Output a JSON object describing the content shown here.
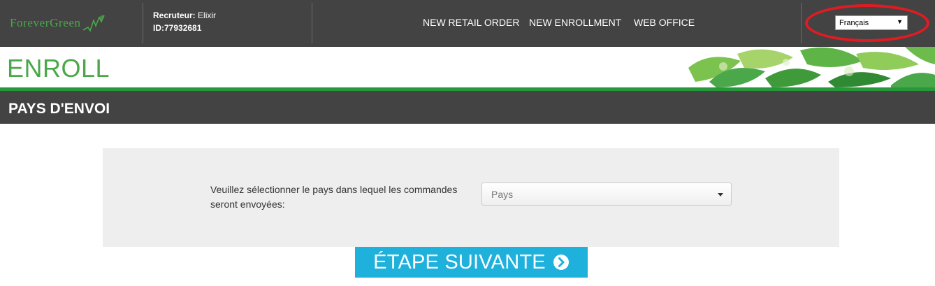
{
  "header": {
    "logo_text": "ForeverGreen",
    "recruiter_label": "Recruteur:",
    "recruiter_name": "Elixir",
    "recruiter_id": "ID:77932681",
    "nav": [
      {
        "label": "NEW RETAIL ORDER"
      },
      {
        "label": "NEW ENROLLMENT"
      },
      {
        "label": "WEB OFFICE"
      }
    ],
    "language_selected": "Français"
  },
  "page": {
    "title": "ENROLL",
    "section_title": "PAYS D'ENVOI"
  },
  "form": {
    "prompt": "Veuillez sélectionner le pays dans lequel les commandes seront envoyées:",
    "country_placeholder": "Pays"
  },
  "actions": {
    "next_label": "ÉTAPE SUIVANTE"
  },
  "colors": {
    "header_bg": "#434343",
    "brand_green": "#4aa84a",
    "accent_green_line": "#27993a",
    "button_blue": "#1eb1dc",
    "panel_bg": "#eeeeee",
    "highlight_red": "#e11b22"
  },
  "icons": {
    "logo_mark": "leaf-zigzag-icon",
    "lang_dropdown": "triangle-down-icon",
    "country_dropdown": "caret-down-icon",
    "next": "chevron-circle-right-icon"
  }
}
